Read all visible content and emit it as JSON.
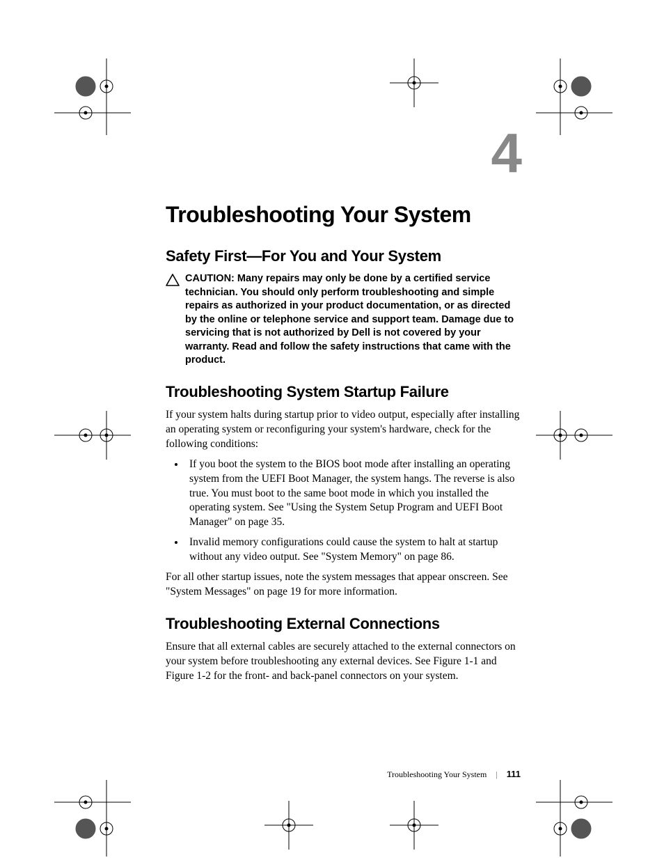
{
  "chapter": {
    "number": "4",
    "title": "Troubleshooting Your System"
  },
  "sections": {
    "safety": {
      "title": "Safety First—For You and Your System",
      "caution_label": "CAUTION: ",
      "caution_text": "Many repairs may only be done by a certified service technician. You should only perform troubleshooting and simple repairs as authorized in your product documentation, or as directed by the online or telephone service and support team. Damage due to servicing that is not authorized by Dell is not covered by your warranty. Read and follow the safety instructions that came with the product."
    },
    "startup": {
      "title": "Troubleshooting System Startup Failure",
      "intro": "If your system halts during startup prior to video output, especially after installing an operating system or reconfiguring your system's hardware, check for the following conditions:",
      "bullets": [
        "If you boot the system to the BIOS boot mode after installing an operating system from the UEFI Boot Manager, the system hangs. The reverse is also true. You must boot to the same boot mode in which you installed the operating system. See \"Using the System Setup Program and UEFI Boot Manager\" on page 35.",
        "Invalid memory configurations could cause the system to halt at startup without any video output. See \"System Memory\" on page 86."
      ],
      "outro": "For all other startup issues, note the system messages that appear onscreen. See \"System Messages\" on page 19 for more information."
    },
    "external": {
      "title": "Troubleshooting External Connections",
      "body": "Ensure that all external cables are securely attached to the external connectors on your system before troubleshooting any external devices. See Figure 1-1 and Figure 1-2 for the front- and back-panel connectors on your system."
    }
  },
  "footer": {
    "title": "Troubleshooting Your System",
    "page": "111"
  }
}
